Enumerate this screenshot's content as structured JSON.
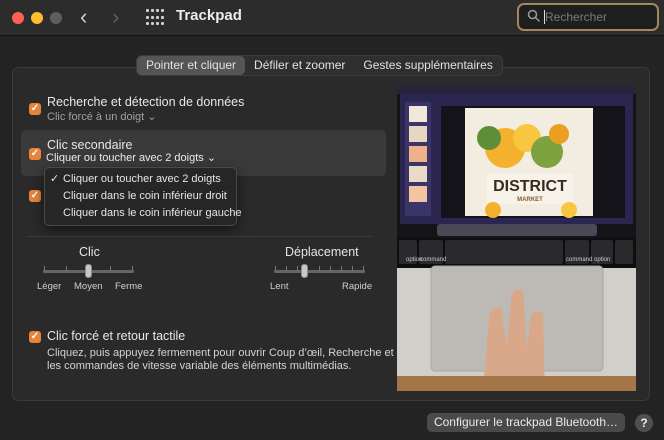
{
  "window": {
    "title": "Trackpad"
  },
  "search": {
    "placeholder": "Rechercher",
    "value": ""
  },
  "tabs": [
    {
      "label": "Pointer et cliquer",
      "selected": true
    },
    {
      "label": "Défiler et zoomer",
      "selected": false
    },
    {
      "label": "Gestes supplémentaires",
      "selected": false
    }
  ],
  "options": {
    "lookup": {
      "label": "Recherche et détection de données",
      "checked": true,
      "sub": "Clic forcé à un doigt"
    },
    "secondary": {
      "label": "Clic secondaire",
      "checked": true,
      "popup_value": "Cliquer ou toucher avec 2 doigts"
    },
    "tap": {
      "checked": true
    },
    "force": {
      "label": "Clic forcé et retour tactile",
      "checked": true,
      "desc_line1": "Cliquez, puis appuyez fermement pour ouvrir Coup d’œil, Recherche et",
      "desc_line2": "les commandes de vitesse variable des éléments multimédias."
    }
  },
  "secondary_menu": [
    {
      "label": "Cliquer ou toucher avec 2 doigts",
      "checked": true
    },
    {
      "label": "Cliquer dans le coin inférieur droit",
      "checked": false
    },
    {
      "label": "Cliquer dans le coin inférieur gauche",
      "checked": false
    }
  ],
  "sliders": {
    "click": {
      "title": "Clic",
      "labels": [
        "Léger",
        "Moyen",
        "Ferme"
      ],
      "level": 0.5
    },
    "tracking": {
      "title": "Déplacement",
      "labels": [
        "Lent",
        "Rapide"
      ],
      "level": 0.34
    }
  },
  "preview": {
    "poster_title": "DISTRICT",
    "poster_sub": "MARKET",
    "keys": {
      "option": "option",
      "command_left": "command",
      "command_right": "command",
      "option_right": "option"
    }
  },
  "footer": {
    "configure_button": "Configurer le trackpad Bluetooth…",
    "help": "?"
  },
  "colors": {
    "accent": "#e8843a",
    "search_focus": "#a3875a",
    "close": "#ff5f57",
    "minimize": "#febc2e",
    "zoom": "#5e5e5e"
  }
}
